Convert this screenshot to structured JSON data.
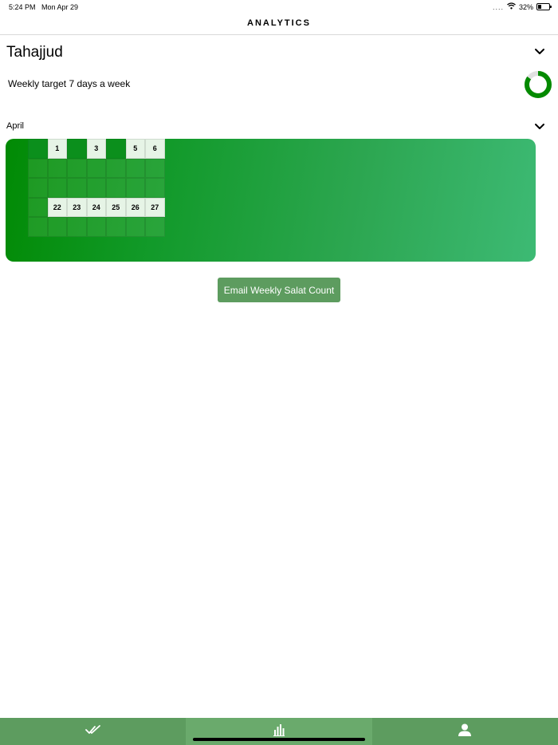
{
  "status_bar": {
    "time": "5:24 PM",
    "date": "Mon Apr 29",
    "signal": "....",
    "battery": "32%",
    "battery_level": 0.32
  },
  "nav": {
    "title": "ANALYTICS"
  },
  "prayer": {
    "name": "Tahajjud",
    "target_text": "Weekly target 7 days a week",
    "progress": 0.85,
    "ring_color": "#048a00"
  },
  "month": {
    "label": "April"
  },
  "calendar": {
    "weeks": [
      [
        {
          "type": "empty"
        },
        {
          "type": "done",
          "label": "1"
        },
        {
          "type": "empty"
        },
        {
          "type": "done",
          "label": "3"
        },
        {
          "type": "empty"
        },
        {
          "type": "done",
          "label": "5"
        },
        {
          "type": "done",
          "label": "6"
        }
      ],
      [
        {
          "type": "day"
        },
        {
          "type": "day"
        },
        {
          "type": "day"
        },
        {
          "type": "day"
        },
        {
          "type": "day"
        },
        {
          "type": "day"
        },
        {
          "type": "day"
        }
      ],
      [
        {
          "type": "day"
        },
        {
          "type": "day"
        },
        {
          "type": "day"
        },
        {
          "type": "day"
        },
        {
          "type": "day"
        },
        {
          "type": "day"
        },
        {
          "type": "day"
        }
      ],
      [
        {
          "type": "day"
        },
        {
          "type": "done",
          "label": "22"
        },
        {
          "type": "done",
          "label": "23"
        },
        {
          "type": "done",
          "label": "24"
        },
        {
          "type": "done",
          "label": "25"
        },
        {
          "type": "done",
          "label": "26"
        },
        {
          "type": "done",
          "label": "27"
        }
      ],
      [
        {
          "type": "day"
        },
        {
          "type": "day"
        },
        {
          "type": "day"
        },
        {
          "type": "day"
        },
        {
          "type": "day"
        },
        {
          "type": "day"
        },
        {
          "type": "day"
        }
      ]
    ]
  },
  "actions": {
    "email_button": "Email Weekly Salat Count"
  },
  "tab_bar": {
    "tabs": [
      {
        "icon": "double-check-icon",
        "active": false
      },
      {
        "icon": "bar-chart-icon",
        "active": true
      },
      {
        "icon": "person-icon",
        "active": false
      }
    ]
  },
  "colors": {
    "brand_green": "#5d9c5f",
    "card_gradient_start": "#018a04",
    "card_gradient_end": "#3dba74"
  }
}
